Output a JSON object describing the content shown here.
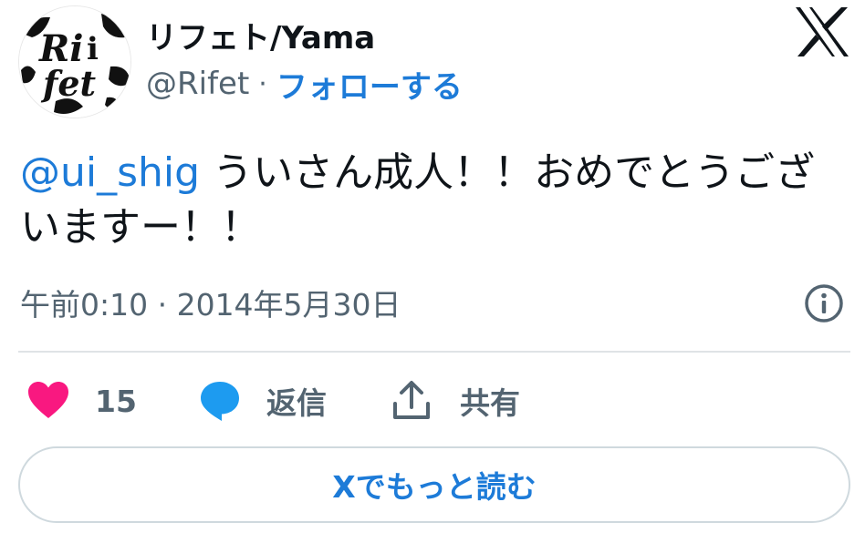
{
  "author": {
    "display_name": "リフェト/Yama",
    "handle": "@Rifet",
    "separator": "·",
    "follow_label": "フォローする",
    "avatar_icon": "rifet-avatar-icon"
  },
  "brand": {
    "logo_icon": "x-logo-icon",
    "color": "#0f1419"
  },
  "tweet": {
    "mention": "@ui_shig",
    "text": " ういさん成人！！おめでとうございますー！！",
    "timestamp": "午前0:10 · 2014年5月30日"
  },
  "actions": {
    "like_count": "15",
    "reply_label": "返信",
    "share_label": "共有"
  },
  "read_more_label": "Xでもっと読む",
  "colors": {
    "accent": "#1d7bd8",
    "like": "#f91880",
    "reply": "#1d9bf0",
    "secondary_text": "#536471",
    "divider": "#dfe3e6"
  }
}
